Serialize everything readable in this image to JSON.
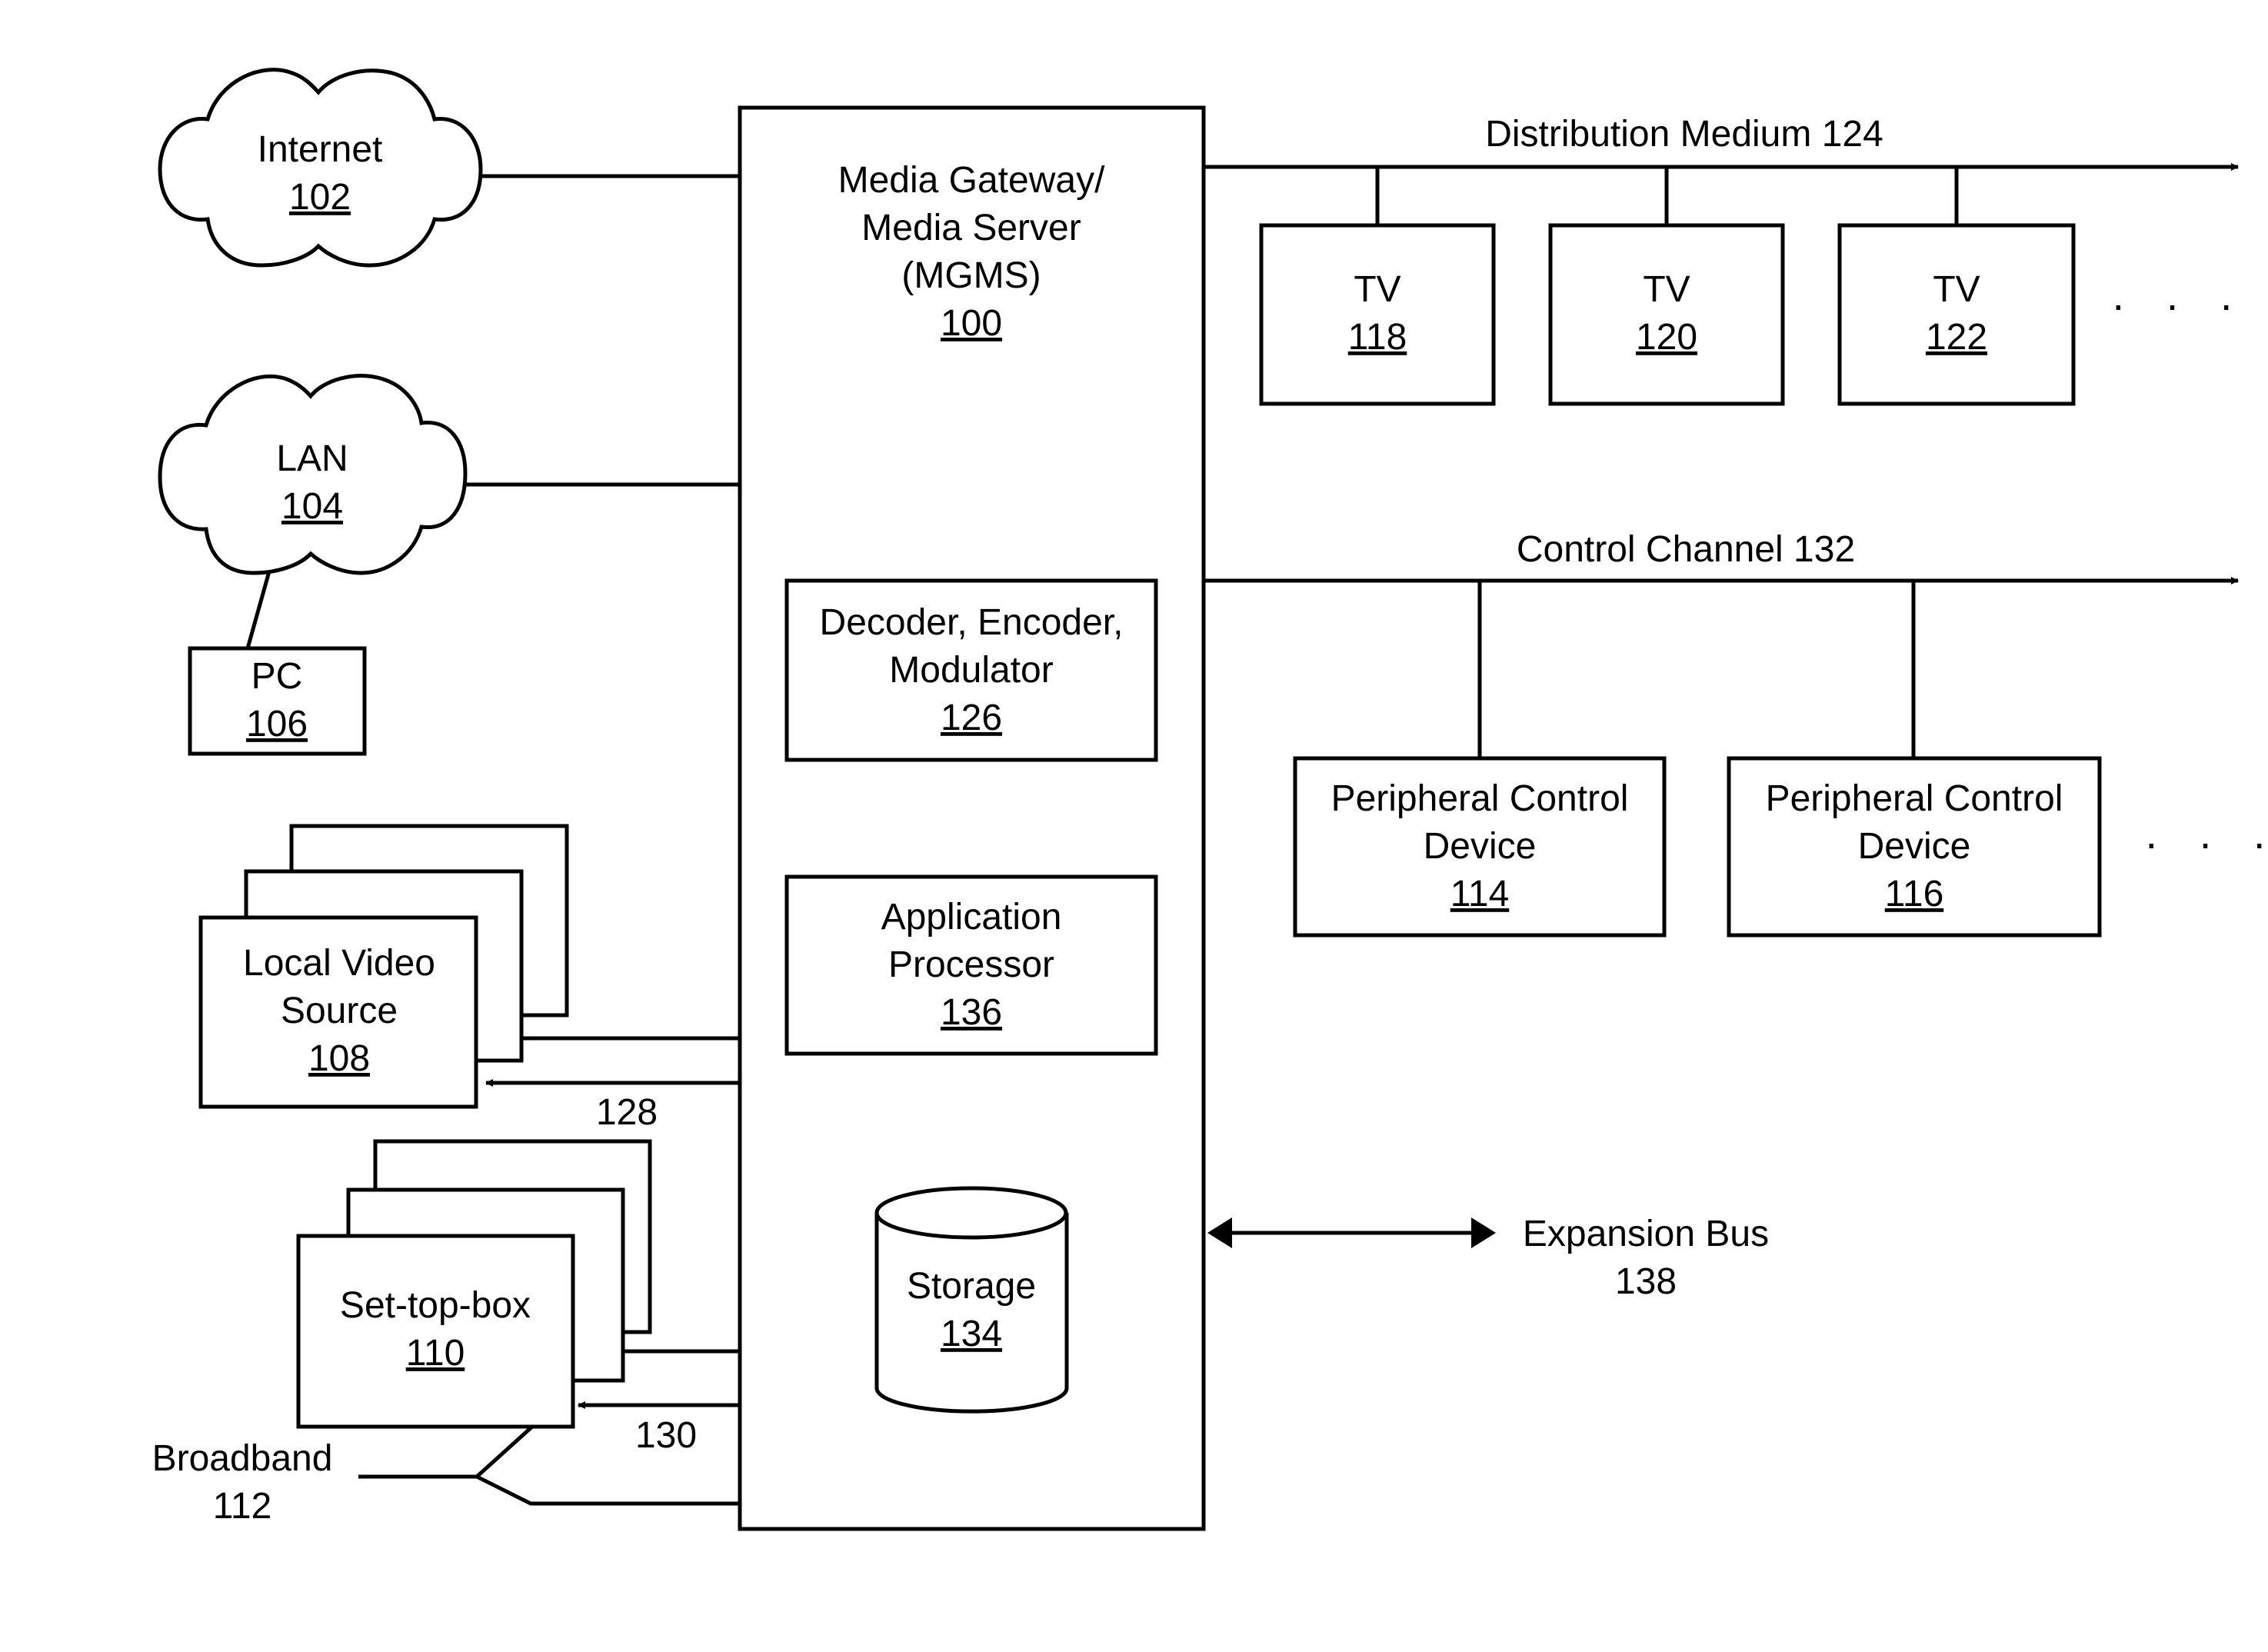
{
  "diagram": {
    "mgms": {
      "lines": [
        "Media Gateway/",
        "Media Server",
        "(MGMS)"
      ],
      "ref": "100"
    },
    "internet": {
      "label": "Internet",
      "ref": "102"
    },
    "lan": {
      "label": "LAN",
      "ref": "104"
    },
    "pc": {
      "label": "PC",
      "ref": "106"
    },
    "local_video": {
      "lines": [
        "Local Video",
        "Source"
      ],
      "ref": "108"
    },
    "link_128": "128",
    "set_top_box": {
      "label": "Set-top-box",
      "ref": "110"
    },
    "link_130": "130",
    "broadband": {
      "label": "Broadband",
      "ref": "112"
    },
    "distribution_medium": "Distribution Medium 124",
    "tvs": [
      {
        "label": "TV",
        "ref": "118"
      },
      {
        "label": "TV",
        "ref": "120"
      },
      {
        "label": "TV",
        "ref": "122"
      }
    ],
    "tv_more": "· · ·",
    "control_channel": "Control Channel 132",
    "peripherals": [
      {
        "lines": [
          "Peripheral Control",
          "Device"
        ],
        "ref": "114"
      },
      {
        "lines": [
          "Peripheral Control",
          "Device"
        ],
        "ref": "116"
      }
    ],
    "peripheral_more": "· · ·",
    "decoder": {
      "lines": [
        "Decoder, Encoder,",
        "Modulator"
      ],
      "ref": "126"
    },
    "app_processor": {
      "lines": [
        "Application",
        "Processor"
      ],
      "ref": "136"
    },
    "storage": {
      "label": "Storage",
      "ref": "134"
    },
    "expansion_bus": {
      "label": "Expansion Bus",
      "ref": "138"
    }
  }
}
